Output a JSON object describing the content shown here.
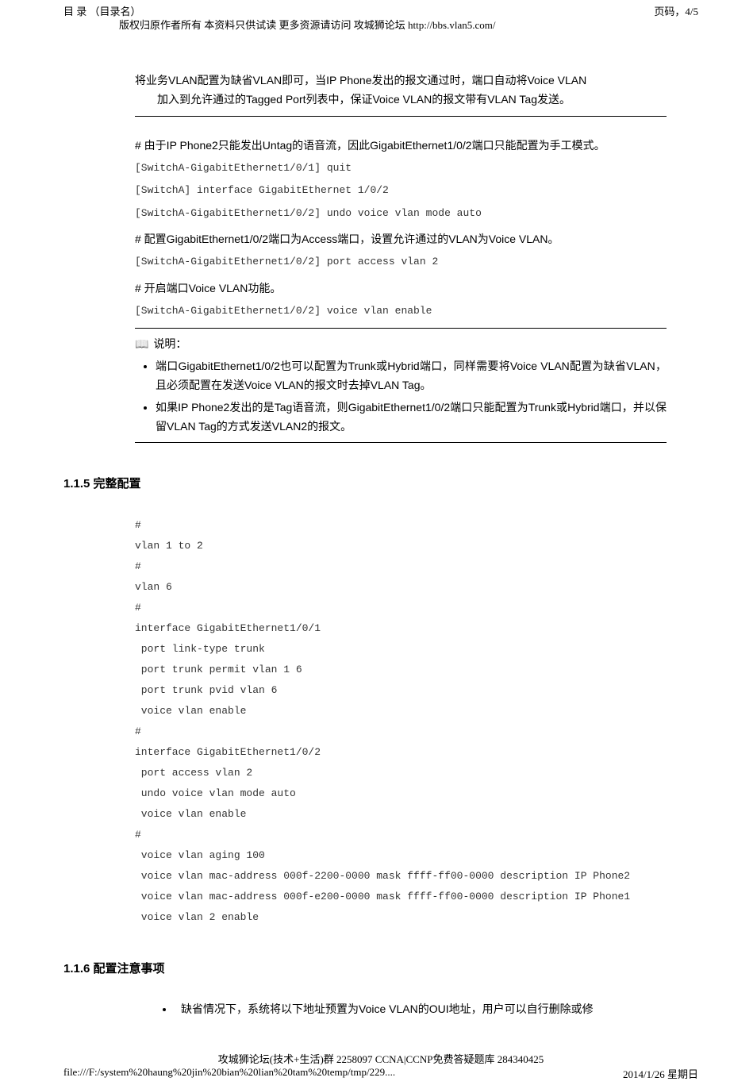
{
  "header": {
    "left": "目 录 （目录名）",
    "right": "页码，4/5",
    "copyright": "版权归原作者所有 本资料只供试读 更多资源请访问 攻城狮论坛 http://bbs.vlan5.com/"
  },
  "intro": {
    "line": "将业务VLAN配置为缺省VLAN即可，当IP Phone发出的报文通过时，端口自动将Voice VLAN",
    "line2": "加入到允许通过的Tagged Port列表中，保证Voice VLAN的报文带有VLAN Tag发送。"
  },
  "block1": {
    "text": "# 由于IP Phone2只能发出Untag的语音流，因此GigabitEthernet1/0/2端口只能配置为手工模式。",
    "cmd1": "[SwitchA-GigabitEthernet1/0/1] quit",
    "cmd2": "[SwitchA] interface GigabitEthernet 1/0/2",
    "cmd3": "[SwitchA-GigabitEthernet1/0/2] undo voice vlan mode auto"
  },
  "block2": {
    "text": "# 配置GigabitEthernet1/0/2端口为Access端口，设置允许通过的VLAN为Voice VLAN。",
    "cmd1": "[SwitchA-GigabitEthernet1/0/2] port access vlan 2"
  },
  "block3": {
    "text": "# 开启端口Voice VLAN功能。",
    "cmd1": "[SwitchA-GigabitEthernet1/0/2] voice vlan enable"
  },
  "note": {
    "label": "说明：",
    "b1": "端口GigabitEthernet1/0/2也可以配置为Trunk或Hybrid端口，同样需要将Voice VLAN配置为缺省VLAN，且必须配置在发送Voice VLAN的报文时去掉VLAN Tag。",
    "b2": "如果IP Phone2发出的是Tag语音流，则GigabitEthernet1/0/2端口只能配置为Trunk或Hybrid端口，并以保留VLAN Tag的方式发送VLAN2的报文。"
  },
  "section115": {
    "title": "1.1.5  完整配置",
    "config": "#\nvlan 1 to 2\n#\nvlan 6\n#\ninterface GigabitEthernet1/0/1\n port link-type trunk\n port trunk permit vlan 1 6\n port trunk pvid vlan 6\n voice vlan enable\n#\ninterface GigabitEthernet1/0/2\n port access vlan 2\n undo voice vlan mode auto\n voice vlan enable\n#\n voice vlan aging 100\n voice vlan mac-address 000f-2200-0000 mask ffff-ff00-0000 description IP Phone2\n voice vlan mac-address 000f-e200-0000 mask ffff-ff00-0000 description IP Phone1\n voice vlan 2 enable"
  },
  "section116": {
    "title": "1.1.6  配置注意事项",
    "b1": "缺省情况下，系统将以下地址预置为Voice VLAN的OUI地址，用户可以自行删除或修"
  },
  "footer": {
    "forum": "攻城狮论坛(技术+生活)群 2258097 CCNA|CCNP免费答疑题库 284340425",
    "path": "file:///F:/system%20haung%20jin%20bian%20lian%20tam%20temp/tmp/229....",
    "date": "2014/1/26 星期日"
  }
}
